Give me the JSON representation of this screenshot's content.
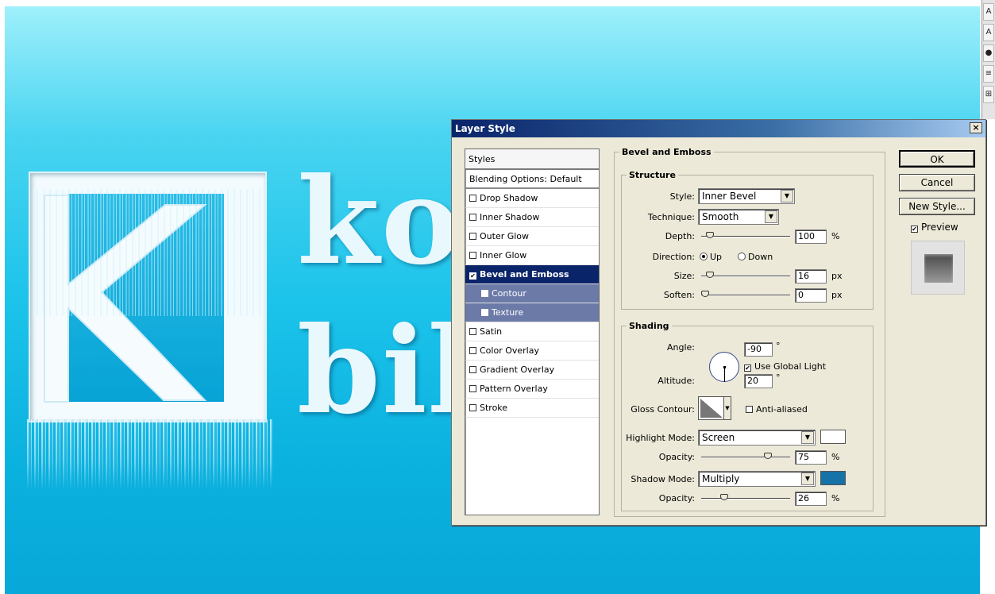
{
  "canvas": {
    "logo_text_line1": "ko",
    "logo_text_line2": "bib"
  },
  "right_palette": {
    "tools": [
      "A",
      "A",
      "●",
      "≡",
      "⊞"
    ]
  },
  "dialog": {
    "title": "Layer Style",
    "close_glyph": "×",
    "styles_panel": {
      "header": "Styles",
      "items": [
        {
          "label": "Blending Options: Default",
          "checkbox": false,
          "checked": false
        },
        {
          "label": "Drop Shadow",
          "checkbox": true,
          "checked": false
        },
        {
          "label": "Inner Shadow",
          "checkbox": true,
          "checked": false
        },
        {
          "label": "Outer Glow",
          "checkbox": true,
          "checked": false
        },
        {
          "label": "Inner Glow",
          "checkbox": true,
          "checked": false
        },
        {
          "label": "Bevel and Emboss",
          "checkbox": true,
          "checked": true
        },
        {
          "label": "Contour",
          "checkbox": true,
          "checked": false
        },
        {
          "label": "Texture",
          "checkbox": true,
          "checked": false
        },
        {
          "label": "Satin",
          "checkbox": true,
          "checked": false
        },
        {
          "label": "Color Overlay",
          "checkbox": true,
          "checked": false
        },
        {
          "label": "Gradient Overlay",
          "checkbox": true,
          "checked": false
        },
        {
          "label": "Pattern Overlay",
          "checkbox": true,
          "checked": false
        },
        {
          "label": "Stroke",
          "checkbox": true,
          "checked": false
        }
      ]
    },
    "bevel": {
      "group_title": "Bevel and Emboss",
      "structure": {
        "title": "Structure",
        "style_label": "Style:",
        "style_value": "Inner Bevel",
        "technique_label": "Technique:",
        "technique_value": "Smooth",
        "depth_label": "Depth:",
        "depth_value": "100",
        "depth_unit": "%",
        "depth_level": 0.1,
        "direction_label": "Direction:",
        "direction_up": "Up",
        "direction_down": "Down",
        "size_label": "Size:",
        "size_value": "16",
        "size_unit": "px",
        "size_level": 0.1,
        "soften_label": "Soften:",
        "soften_value": "0",
        "soften_unit": "px",
        "soften_level": 0.0
      },
      "shading": {
        "title": "Shading",
        "angle_label": "Angle:",
        "angle_value": "-90",
        "degree": "°",
        "global_light_label": "Use Global Light",
        "altitude_label": "Altitude:",
        "altitude_value": "20",
        "gloss_contour_label": "Gloss Contour:",
        "anti_aliased_label": "Anti-aliased",
        "highlight_mode_label": "Highlight Mode:",
        "highlight_mode_value": "Screen",
        "highlight_color": "#ffffff",
        "highlight_opacity_label": "Opacity:",
        "highlight_opacity_value": "75",
        "highlight_opacity_unit": "%",
        "shadow_mode_label": "Shadow Mode:",
        "shadow_mode_value": "Multiply",
        "shadow_color": "#1573a8",
        "shadow_opacity_label": "Opacity:",
        "shadow_opacity_value": "26",
        "shadow_opacity_unit": "%"
      }
    },
    "buttons": {
      "ok": "OK",
      "cancel": "Cancel",
      "new_style": "New Style...",
      "preview_label": "Preview"
    }
  }
}
